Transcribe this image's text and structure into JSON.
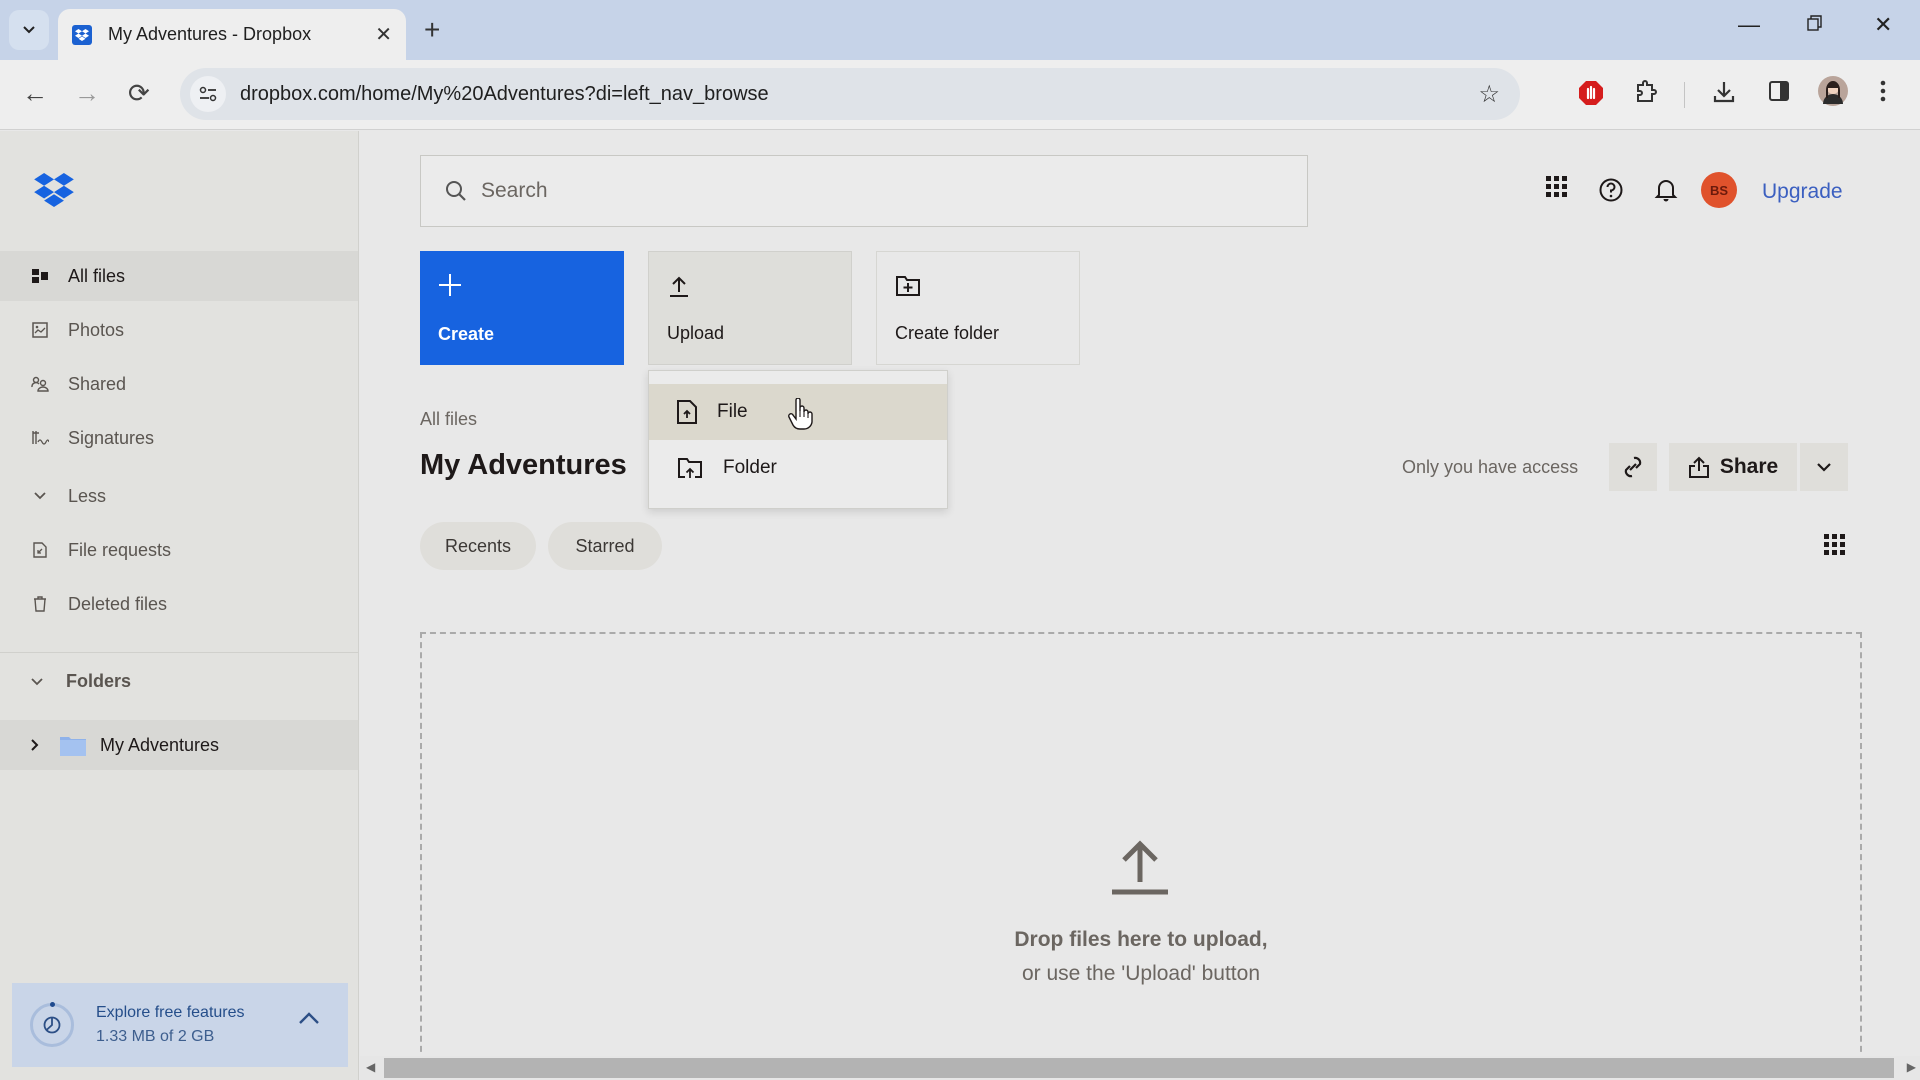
{
  "browser": {
    "tab_title": "My Adventures - Dropbox",
    "url": "dropbox.com/home/My%20Adventures?di=left_nav_browse",
    "icons": [
      "tab-search-icon",
      "dropbox-favicon",
      "close-tab-icon",
      "new-tab-icon",
      "minimize-icon",
      "restore-icon",
      "close-window-icon",
      "back-icon",
      "forward-icon",
      "reload-icon",
      "site-settings-icon",
      "bookmark-star-icon",
      "adblock-icon",
      "extensions-icon",
      "downloads-icon",
      "side-panel-icon",
      "profile-avatar",
      "menu-kebab-icon"
    ]
  },
  "sidebar": {
    "items": [
      {
        "label": "All files",
        "icon": "all-files-icon",
        "active": true
      },
      {
        "label": "Photos",
        "icon": "photos-icon"
      },
      {
        "label": "Shared",
        "icon": "shared-icon"
      },
      {
        "label": "Signatures",
        "icon": "signatures-icon"
      },
      {
        "label": "Less",
        "icon": "chevron-down-icon"
      },
      {
        "label": "File requests",
        "icon": "file-requests-icon"
      },
      {
        "label": "Deleted files",
        "icon": "trash-icon"
      }
    ],
    "folders_heading": "Folders",
    "folders": [
      {
        "label": "My Adventures"
      }
    ],
    "explore": {
      "title": "Explore free features",
      "usage": "1.33 MB of 2 GB"
    }
  },
  "header": {
    "search_placeholder": "Search",
    "avatar_initials": "BS",
    "upgrade_label": "Upgrade"
  },
  "actions": {
    "create": "Create",
    "upload": "Upload",
    "create_folder": "Create folder"
  },
  "upload_menu": {
    "items": [
      {
        "label": "File",
        "icon": "file-upload-icon",
        "hovered": true
      },
      {
        "label": "Folder",
        "icon": "folder-upload-icon"
      }
    ]
  },
  "page": {
    "breadcrumb": "All files",
    "title": "My Adventures",
    "access_text": "Only you have access",
    "share_label": "Share",
    "chips": [
      "Recents",
      "Starred"
    ],
    "dropzone_title": "Drop files here to upload,",
    "dropzone_subtitle": "or use the 'Upload' button"
  },
  "colors": {
    "brand_blue": "#1763e0",
    "avatar_bg": "#e0522c",
    "upgrade_link": "#3b5fc0"
  }
}
